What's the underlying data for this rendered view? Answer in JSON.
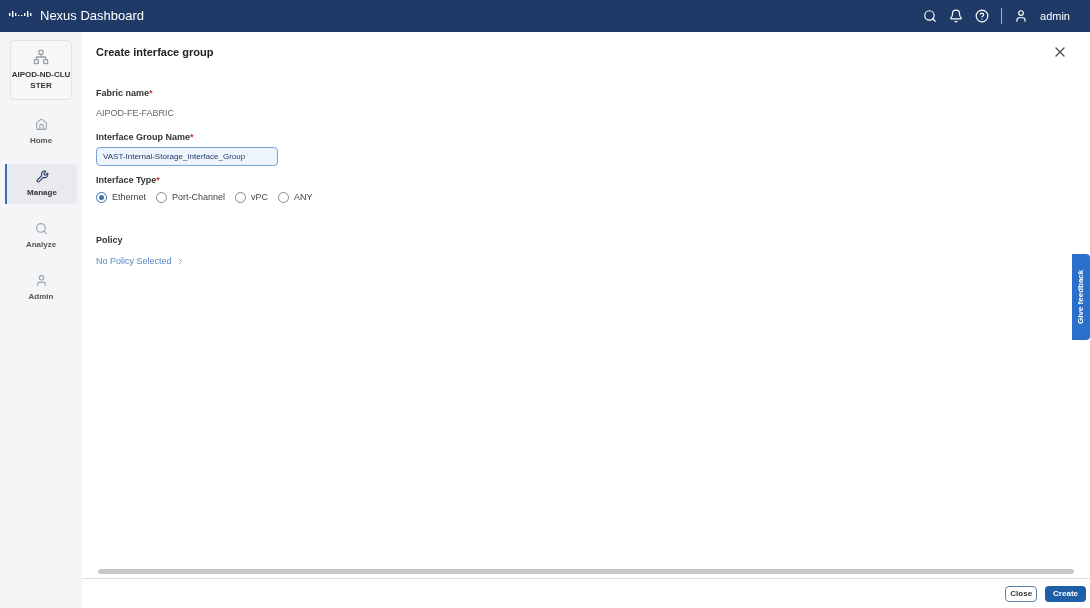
{
  "header": {
    "title": "Nexus Dashboard",
    "user": "admin"
  },
  "sidebar": {
    "cluster": "AIPOD-ND-CLUSTER",
    "items": [
      {
        "label": "Home",
        "selected": false
      },
      {
        "label": "Manage",
        "selected": true
      },
      {
        "label": "Analyze",
        "selected": false
      },
      {
        "label": "Admin",
        "selected": false
      }
    ]
  },
  "dialog": {
    "title": "Create interface group",
    "required_mark": "*",
    "fabric_required": true,
    "group_required": true,
    "type_required": true,
    "fabric_label": "Fabric name",
    "fabric_value": "AIPOD-FE-FABRIC",
    "group_label": "Interface Group Name",
    "group_value": "VAST-Internal-Storage_Interface_Group",
    "type_label": "Interface Type",
    "types": [
      {
        "label": "Ethernet",
        "selected": true
      },
      {
        "label": "Port-Channel",
        "selected": false
      },
      {
        "label": "vPC",
        "selected": false
      },
      {
        "label": "ANY",
        "selected": false
      }
    ],
    "policy_label": "Policy",
    "policy_link": "No Policy Selected"
  },
  "feedback": "Give feedback",
  "buttons": {
    "close": "Close",
    "create": "Create"
  }
}
